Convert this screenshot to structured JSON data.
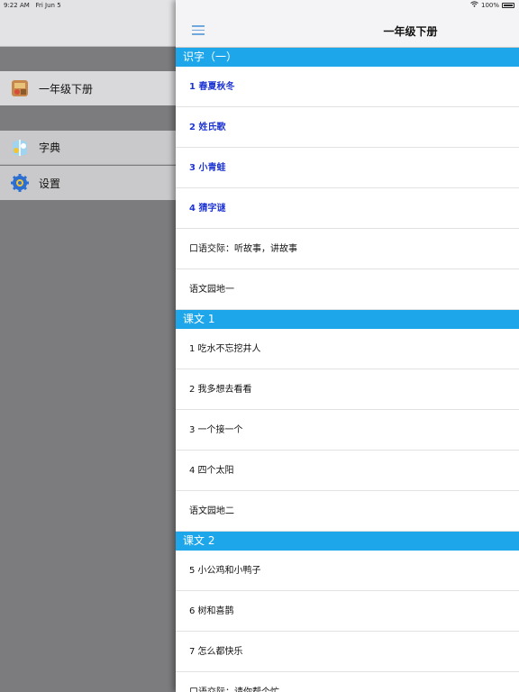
{
  "status_bar": {
    "time": "9:22 AM",
    "date": "Fri Jun 5",
    "battery": "100%",
    "battery_level": 1.0
  },
  "sidebar": {
    "items": [
      {
        "label": "一年级下册",
        "icon": "book-icon"
      },
      {
        "label": "字典",
        "icon": "dictionary-icon"
      },
      {
        "label": "设置",
        "icon": "gear-icon"
      }
    ]
  },
  "header": {
    "title": "一年级下册",
    "menu_icon": "hamburger-menu-icon"
  },
  "colors": {
    "section_header": "#1da6ea",
    "highlight_text": "#1f35d2",
    "sidebar_bg": "#7c7c7e"
  },
  "sections": [
    {
      "title": "识字（一）",
      "items": [
        {
          "label": "1 春夏秋冬",
          "highlighted": true
        },
        {
          "label": "2 姓氏歌",
          "highlighted": true
        },
        {
          "label": "3 小青蛙",
          "highlighted": true
        },
        {
          "label": "4 猜字谜",
          "highlighted": true
        },
        {
          "label": "口语交际：听故事，讲故事",
          "highlighted": false
        },
        {
          "label": "语文园地一",
          "highlighted": false
        }
      ]
    },
    {
      "title": "课文 1",
      "items": [
        {
          "label": "1 吃水不忘挖井人",
          "highlighted": false
        },
        {
          "label": "2 我多想去看看",
          "highlighted": false
        },
        {
          "label": "3 一个接一个",
          "highlighted": false
        },
        {
          "label": "4 四个太阳",
          "highlighted": false
        },
        {
          "label": "语文园地二",
          "highlighted": false
        }
      ]
    },
    {
      "title": "课文 2",
      "items": [
        {
          "label": "5 小公鸡和小鸭子",
          "highlighted": false
        },
        {
          "label": "6 树和喜鹊",
          "highlighted": false
        },
        {
          "label": "7 怎么都快乐",
          "highlighted": false
        },
        {
          "label": "口语交际：请你帮个忙",
          "highlighted": false
        }
      ]
    }
  ]
}
